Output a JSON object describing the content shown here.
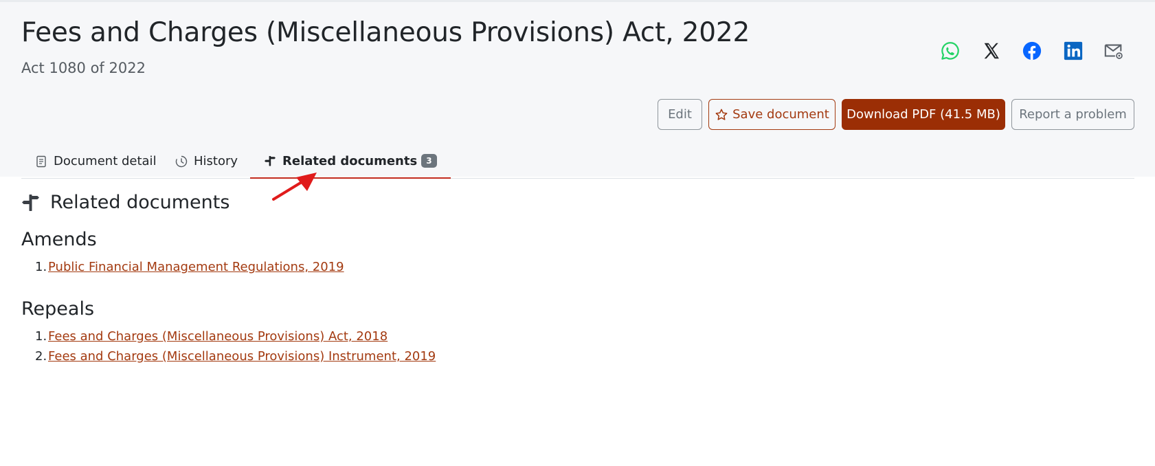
{
  "document": {
    "title": "Fees and Charges (Miscellaneous Provisions) Act, 2022",
    "subtitle": "Act 1080 of 2022"
  },
  "share": [
    {
      "icon": "whatsapp-icon",
      "color": "#25d366"
    },
    {
      "icon": "x-twitter-icon",
      "color": "#212529"
    },
    {
      "icon": "facebook-icon",
      "color": "#0866ff"
    },
    {
      "icon": "linkedin-icon",
      "color": "#0a66c2"
    },
    {
      "icon": "email-icon",
      "color": "#5a6068"
    }
  ],
  "actions": {
    "edit_label": "Edit",
    "save_label": "Save document",
    "download_label": "Download PDF (41.5 MB)",
    "report_label": "Report a problem"
  },
  "tabs": [
    {
      "label": "Document detail",
      "icon": "document-icon"
    },
    {
      "label": "History",
      "icon": "clock-icon"
    },
    {
      "label": "Related documents",
      "icon": "signpost-icon",
      "badge": "3",
      "active": true
    }
  ],
  "related": {
    "heading": "Related documents",
    "amends": {
      "heading": "Amends",
      "items": [
        {
          "num": "1.",
          "label": "Public Financial Management Regulations, 2019"
        }
      ]
    },
    "repeals": {
      "heading": "Repeals",
      "items": [
        {
          "num": "1.",
          "label": "Fees and Charges (Miscellaneous Provisions) Act, 2018"
        },
        {
          "num": "2.",
          "label": "Fees and Charges (Miscellaneous Provisions) Instrument, 2019"
        }
      ]
    }
  },
  "colors": {
    "accent": "#9b2e05",
    "link": "#a33a10",
    "active_tab_underline": "#c12a1d",
    "annotation_arrow": "#e01b1b"
  }
}
